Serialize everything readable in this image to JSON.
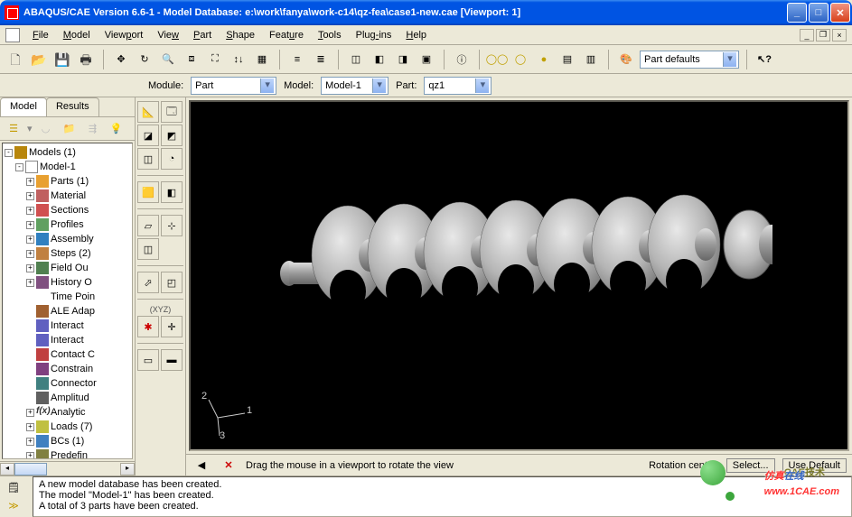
{
  "title": "ABAQUS/CAE Version 6.6-1 - Model Database: e:\\work\\fanya\\work-c14\\qz-fea\\case1-new.cae [Viewport: 1]",
  "menus": [
    "File",
    "Model",
    "Viewport",
    "View",
    "Part",
    "Shape",
    "Feature",
    "Tools",
    "Plug-ins",
    "Help"
  ],
  "menu_underlines": [
    0,
    0,
    4,
    3,
    0,
    0,
    4,
    0,
    4,
    0
  ],
  "toolbar_combo": "Part defaults",
  "context": {
    "module_label": "Module:",
    "module_value": "Part",
    "model_label": "Model:",
    "model_value": "Model-1",
    "part_label": "Part:",
    "part_value": "qz1"
  },
  "left_tabs": {
    "model": "Model",
    "results": "Results"
  },
  "tree": {
    "root": "Models (1)",
    "model": "Model-1",
    "nodes": [
      {
        "icon": "i-parts",
        "label": "Parts (1)"
      },
      {
        "icon": "i-mat",
        "label": "Material"
      },
      {
        "icon": "i-sec",
        "label": "Sections"
      },
      {
        "icon": "i-prof",
        "label": "Profiles"
      },
      {
        "icon": "i-asm",
        "label": "Assembly"
      },
      {
        "icon": "i-steps",
        "label": "Steps (2)"
      },
      {
        "icon": "i-field",
        "label": "Field Ou"
      },
      {
        "icon": "i-hist",
        "label": "History O"
      },
      {
        "icon": "i-time",
        "label": "Time Poin",
        "leaf": true
      },
      {
        "icon": "i-ale",
        "label": "ALE Adap",
        "leaf": true
      },
      {
        "icon": "i-int",
        "label": "Interact",
        "leaf": true
      },
      {
        "icon": "i-int",
        "label": "Interact",
        "leaf": true
      },
      {
        "icon": "i-cont",
        "label": "Contact C",
        "leaf": true
      },
      {
        "icon": "i-cons",
        "label": "Constrain",
        "leaf": true
      },
      {
        "icon": "i-conn",
        "label": "Connector",
        "leaf": true
      },
      {
        "icon": "i-amp",
        "label": "Amplitud",
        "leaf": true
      },
      {
        "icon": "i-anal",
        "label": "Analytic"
      },
      {
        "icon": "i-loads",
        "label": "Loads (7)"
      },
      {
        "icon": "i-bcs",
        "label": "BCs (1)"
      },
      {
        "icon": "i-pred",
        "label": "Predefin"
      }
    ]
  },
  "status": {
    "hint": "Drag the mouse in a viewport to rotate the view",
    "rc_label": "Rotation center:",
    "select": "Select...",
    "default": "Use Default"
  },
  "messages": [
    "A new model database has been created.",
    "The model \"Model-1\" has been created.",
    "A total of 3 parts have been created."
  ],
  "triad": {
    "a": "2",
    "b": "1",
    "c": "3"
  },
  "watermark1_a": "仿真",
  "watermark1_b": "在线",
  "watermark2": "CAE技术",
  "watermark_url": "www.1CAE.com",
  "vtoolbar_xyz": "(XYZ)"
}
